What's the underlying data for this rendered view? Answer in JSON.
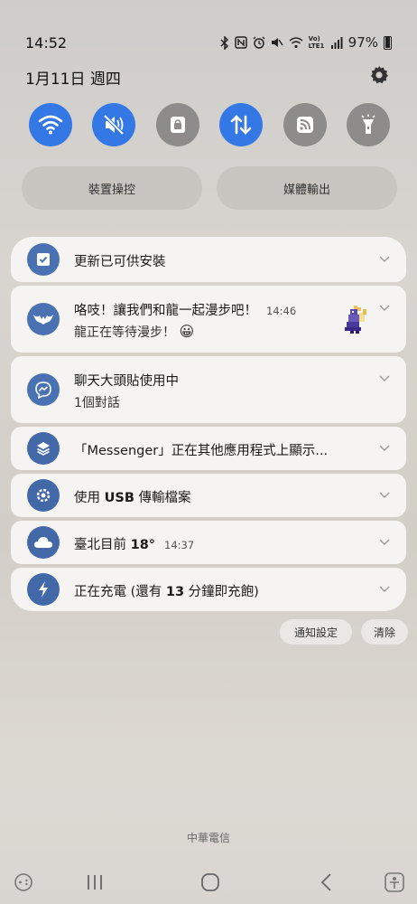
{
  "status_bar": {
    "time": "14:52",
    "network_label": "Vo) LTE1",
    "battery_percent": "97%"
  },
  "panel": {
    "date": "1月11日 週四"
  },
  "quick_settings": [
    {
      "name": "wifi",
      "state": "on",
      "icon": "wifi-icon"
    },
    {
      "name": "sound",
      "state": "on",
      "icon": "mute-icon"
    },
    {
      "name": "rotation-lock",
      "state": "off",
      "icon": "lock-icon"
    },
    {
      "name": "mobile-data",
      "state": "on",
      "icon": "data-arrows-icon"
    },
    {
      "name": "cast",
      "state": "off",
      "icon": "cast-icon"
    },
    {
      "name": "flashlight",
      "state": "off",
      "icon": "flashlight-icon"
    }
  ],
  "pills": {
    "device_control": "裝置操控",
    "media_output": "媒體輸出"
  },
  "notifications": [
    {
      "title": "更新已可供安裝",
      "icon": "update-icon"
    },
    {
      "title": "咯吱！讓我們和龍一起漫步吧！",
      "time": "14:46",
      "text": "龍正在等待漫步！",
      "emoji": "😀",
      "icon": "bat-wing-icon"
    },
    {
      "title": "聊天大頭貼使用中",
      "text": "1個對話",
      "icon": "messenger-icon"
    },
    {
      "title": "「Messenger」正在其他應用程式上顯示...",
      "icon": "layers-icon"
    },
    {
      "title_prefix": "使用 ",
      "title_bold": "USB",
      "title_suffix": " 傳輸檔案",
      "icon": "usb-settings-icon"
    },
    {
      "title_prefix": "臺北目前 ",
      "title_bold": "18°",
      "time": "14:37",
      "icon": "cloud-icon"
    },
    {
      "title_prefix": "正在充電 (還有 ",
      "title_bold": "13",
      "title_suffix": " 分鐘即充飽)",
      "icon": "charging-icon"
    }
  ],
  "actions": {
    "notification_settings": "通知設定",
    "clear": "清除"
  },
  "carrier": "中華電信",
  "colors": {
    "accent": "#3478e6",
    "tile_off": "#8e8c8a",
    "avatar": "#4a72b2"
  }
}
